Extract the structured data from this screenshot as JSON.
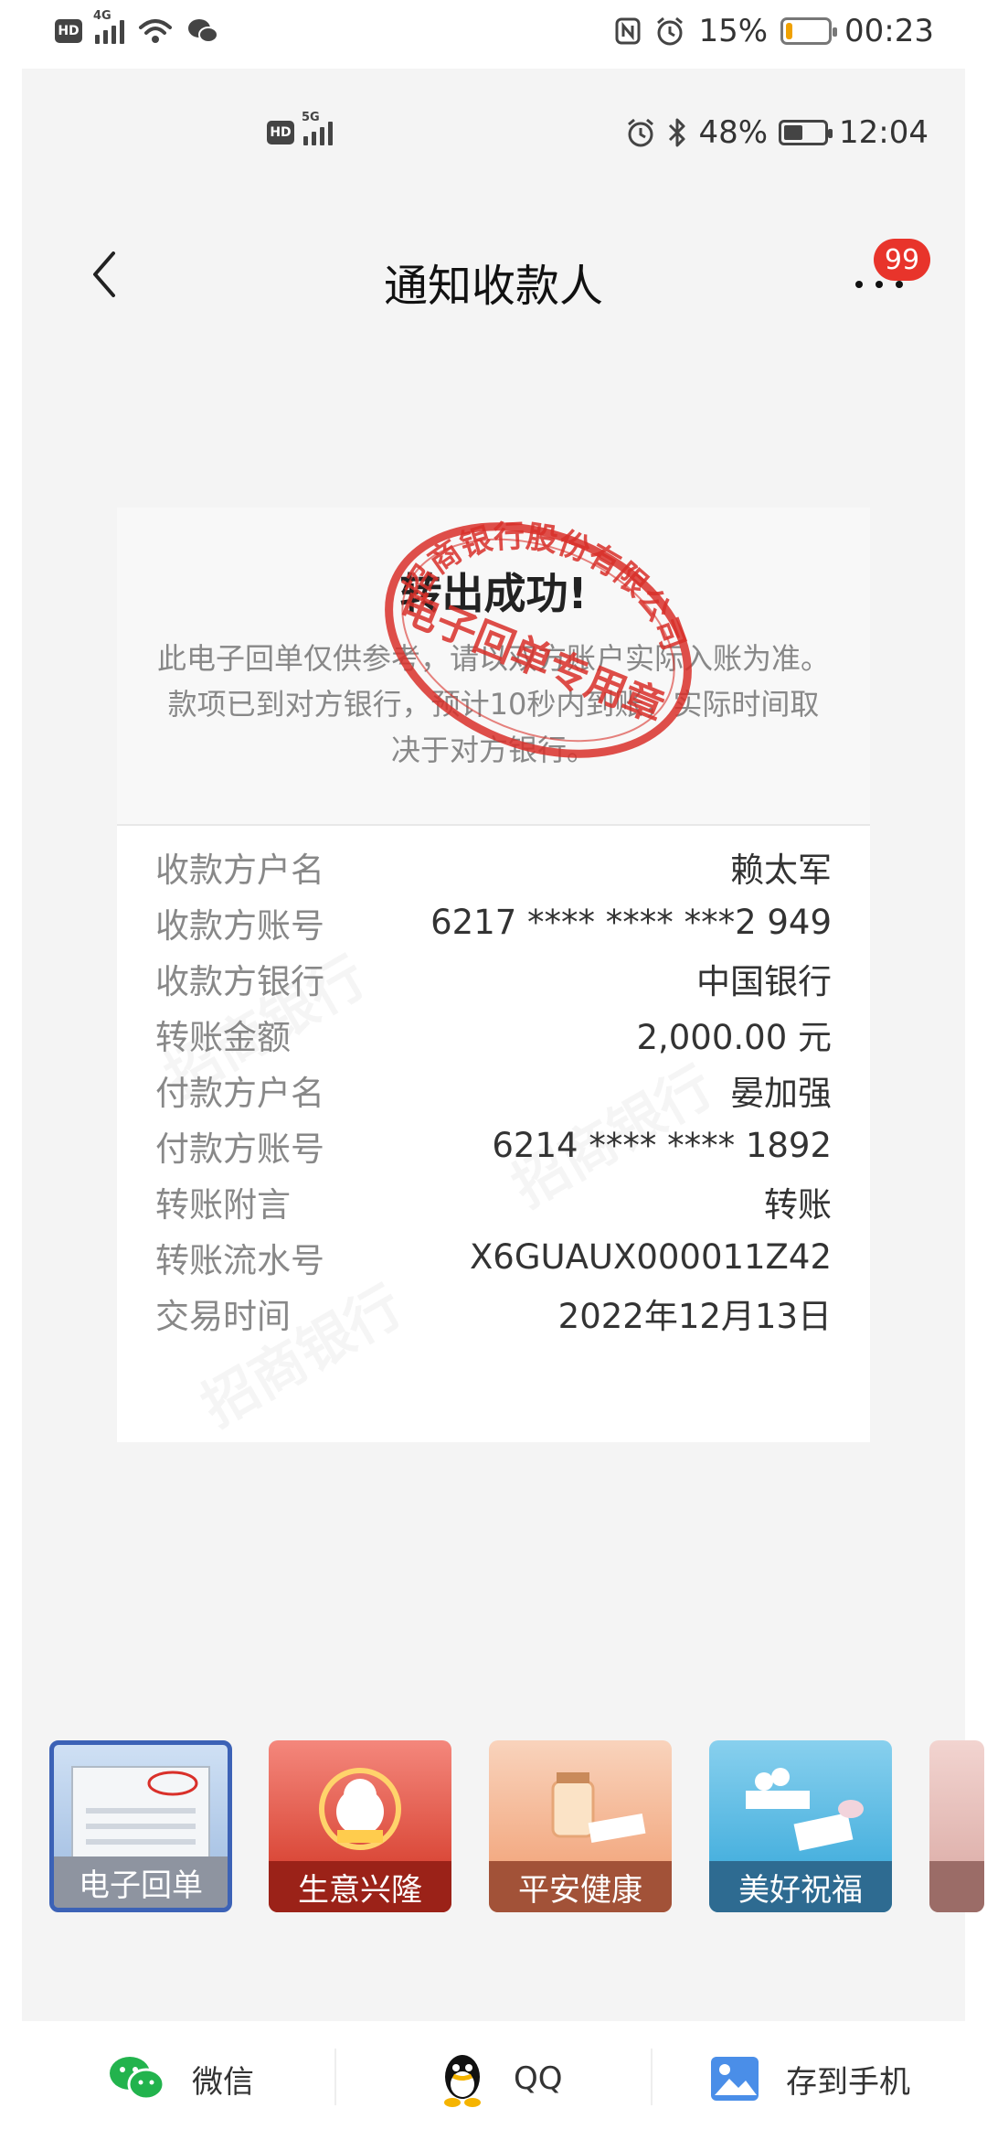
{
  "outer_status": {
    "battery_text": "15%",
    "time": "00:23",
    "battery_level_fraction": 0.15
  },
  "inner_status": {
    "signal_tag": "5G",
    "battery_text": "48%",
    "time": "12:04",
    "battery_level_fraction": 0.48
  },
  "nav": {
    "title": "通知收款人",
    "badge_count": "99"
  },
  "receipt": {
    "title": "转出成功!",
    "note": "此电子回单仅供参考，请以双方账户实际入账为准。款项已到对方银行，预计10秒内到账，实际时间取决于对方银行。",
    "stamp_outer_text": "招商银行股份有限公司",
    "stamp_inner_text": "电子回单专用章",
    "rows": [
      {
        "label": "收款方户名",
        "value": "赖太军"
      },
      {
        "label": "收款方账号",
        "value": "6217 **** **** ***2 949"
      },
      {
        "label": "收款方银行",
        "value": "中国银行"
      },
      {
        "label": "转账金额",
        "value": "2,000.00 元"
      },
      {
        "label": "付款方户名",
        "value": "晏加强"
      },
      {
        "label": "付款方账号",
        "value": "6214 **** **** 1892"
      },
      {
        "label": "转账附言",
        "value": "转账"
      },
      {
        "label": "转账流水号",
        "value": "X6GUAUX000011Z42"
      },
      {
        "label": "交易时间",
        "value": "2022年12月13日"
      }
    ]
  },
  "cards": [
    {
      "label": "电子回单",
      "selected": true
    },
    {
      "label": "生意兴隆"
    },
    {
      "label": "平安健康"
    },
    {
      "label": "美好祝福"
    }
  ],
  "share": {
    "wechat_label": "微信",
    "qq_label": "QQ",
    "save_label": "存到手机"
  },
  "colors": {
    "badge": "#e8342b",
    "stamp_red": "#d9302a",
    "selected_border": "#3c62b6",
    "wechat_green": "#22b34d",
    "photo_blue": "#4a8ee8"
  }
}
